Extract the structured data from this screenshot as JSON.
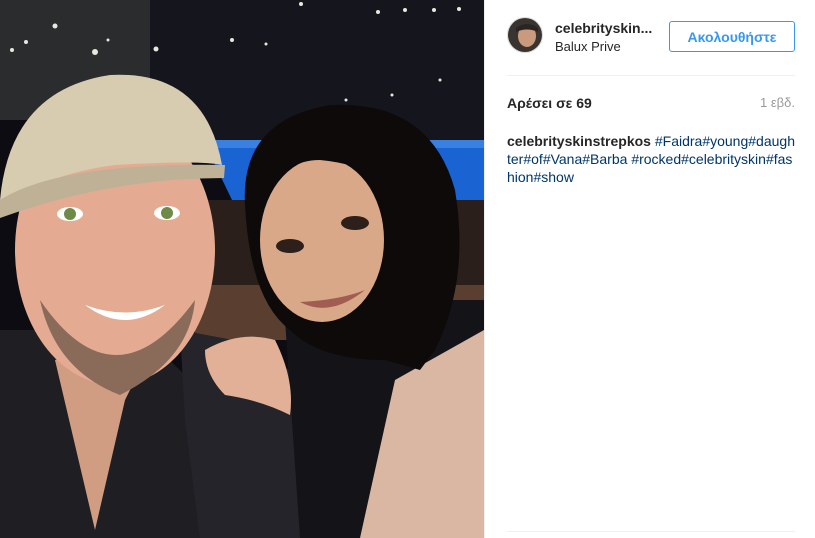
{
  "post": {
    "username": "celebrityskin...",
    "location": "Balux Prive",
    "follow_label": "Ακολουθήστε",
    "likes": "Αρέσει σε 69",
    "time_ago": "1 εβδ."
  },
  "caption": {
    "user": "celebrityskinstrepkos",
    "hashtags": [
      "#Faidra",
      "#young",
      "#daughter",
      "#of",
      "#Vana",
      "#Barba",
      "#rocked",
      "#celebrityskin",
      "#fashion",
      "#show"
    ]
  },
  "colors": {
    "accent": "#3897f0",
    "hashtag": "#003569",
    "text": "#262626",
    "muted": "#999999"
  }
}
